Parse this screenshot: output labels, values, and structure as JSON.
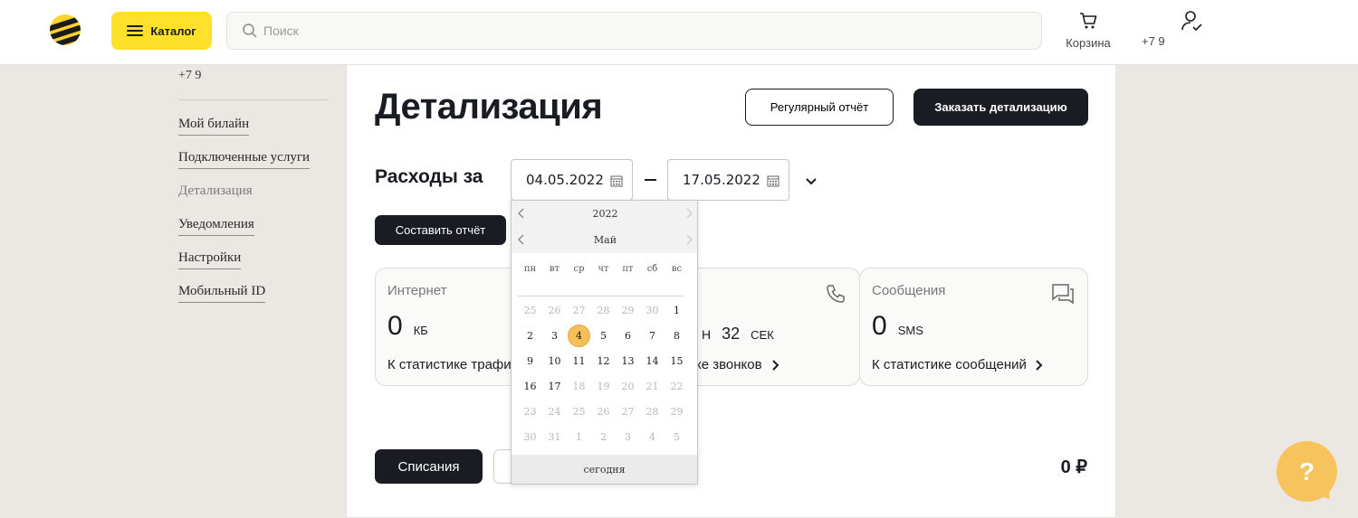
{
  "header": {
    "catalog_label": "Каталог",
    "search_placeholder": "Поиск",
    "cart_label": "Корзина",
    "phone": "+7 9"
  },
  "sidebar": {
    "phone": "+7 9",
    "items": [
      {
        "label": "Мой билайн",
        "active": false
      },
      {
        "label": "Подключенные услуги",
        "active": false
      },
      {
        "label": "Детализация",
        "active": true
      },
      {
        "label": "Уведомления",
        "active": false
      },
      {
        "label": "Настройки",
        "active": false
      },
      {
        "label": "Мобильный ID",
        "active": false
      }
    ]
  },
  "main": {
    "title": "Детализация",
    "regular_report_label": "Регулярный отчёт",
    "order_details_label": "Заказать детализацию",
    "expense_label": "Расходы за",
    "date_from": "04.05.2022",
    "date_to": "17.05.2022",
    "make_report_label": "Составить отчёт",
    "cards": {
      "internet": {
        "title": "Интернет",
        "value": "0",
        "unit": "КБ",
        "link": "К статистике трафи"
      },
      "calls": {
        "value_prefix": "Н",
        "value": "32",
        "unit": "СЕК",
        "link": "ке звонков"
      },
      "sms": {
        "title": "Сообщения",
        "value": "0",
        "unit": "SMS",
        "link": "К статистике сообщений"
      }
    },
    "tab_active_label": "Списания",
    "total": "0 ₽"
  },
  "calendar": {
    "year": "2022",
    "month": "Май",
    "weekdays": [
      "пн",
      "вт",
      "ср",
      "чт",
      "пт",
      "сб",
      "вс"
    ],
    "days": [
      [
        "25",
        "26",
        "27",
        "28",
        "29",
        "30",
        "1"
      ],
      [
        "2",
        "3",
        "4",
        "5",
        "6",
        "7",
        "8"
      ],
      [
        "9",
        "10",
        "11",
        "12",
        "13",
        "14",
        "15"
      ],
      [
        "16",
        "17",
        "18",
        "19",
        "20",
        "21",
        "22"
      ],
      [
        "23",
        "24",
        "25",
        "26",
        "27",
        "28",
        "29"
      ],
      [
        "30",
        "31",
        "1",
        "2",
        "3",
        "4",
        "5"
      ]
    ],
    "selected": "4",
    "today_label": "сегодня"
  },
  "help": {
    "label": "?"
  },
  "colors": {
    "brand_yellow": "#ffe12b",
    "dark": "#191c22",
    "help_orange": "#f7c35c",
    "background": "#ebe8e3"
  }
}
